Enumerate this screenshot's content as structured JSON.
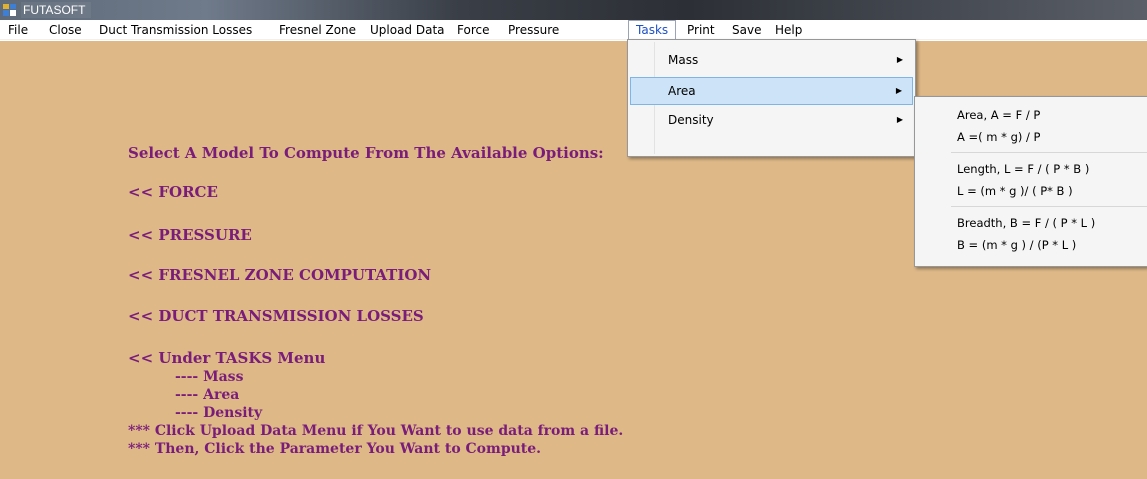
{
  "window": {
    "title": "FUTASOFT"
  },
  "menubar": {
    "items": [
      {
        "label": "File"
      },
      {
        "label": "Close"
      },
      {
        "label": "Duct Transmission Losses"
      },
      {
        "label": "Fresnel Zone"
      },
      {
        "label": "Upload Data"
      },
      {
        "label": "Force"
      },
      {
        "label": "Pressure"
      },
      {
        "label": "Tasks"
      },
      {
        "label": "Print"
      },
      {
        "label": "Save"
      },
      {
        "label": "Help"
      }
    ],
    "open_item": "Tasks"
  },
  "tasks_menu": {
    "items": [
      {
        "label": "Mass",
        "arrow": "▶"
      },
      {
        "label": "Area",
        "arrow": "▶"
      },
      {
        "label": "Density",
        "arrow": "▶"
      }
    ],
    "highlighted": "Area"
  },
  "area_submenu": {
    "items": [
      {
        "label": "Area, A = F / P"
      },
      {
        "label": "A =( m * g) / P"
      },
      {
        "label": "Length, L = F / ( P * B )"
      },
      {
        "label": "L = (m * g )/ ( P* B )"
      },
      {
        "label": "Breadth, B =  F / ( P * L )"
      },
      {
        "label": "B = (m * g ) / (P * L )"
      }
    ]
  },
  "main": {
    "lines": [
      "Select A Model To Compute From The Available Options:",
      "<<  FORCE",
      "<<  PRESSURE",
      "<<  FRESNEL ZONE COMPUTATION",
      "<<  DUCT TRANSMISSION LOSSES",
      "<<  Under TASKS Menu",
      "---- Mass",
      "---- Area",
      "---- Density",
      "*** Click Upload Data Menu if You Want to use data from a file.",
      "*** Then, Click the Parameter You Want to Compute."
    ]
  },
  "colors": {
    "form_background": "#deb887",
    "text_purple": "#7a1c7a",
    "menu_highlight": "#cde4f8"
  }
}
